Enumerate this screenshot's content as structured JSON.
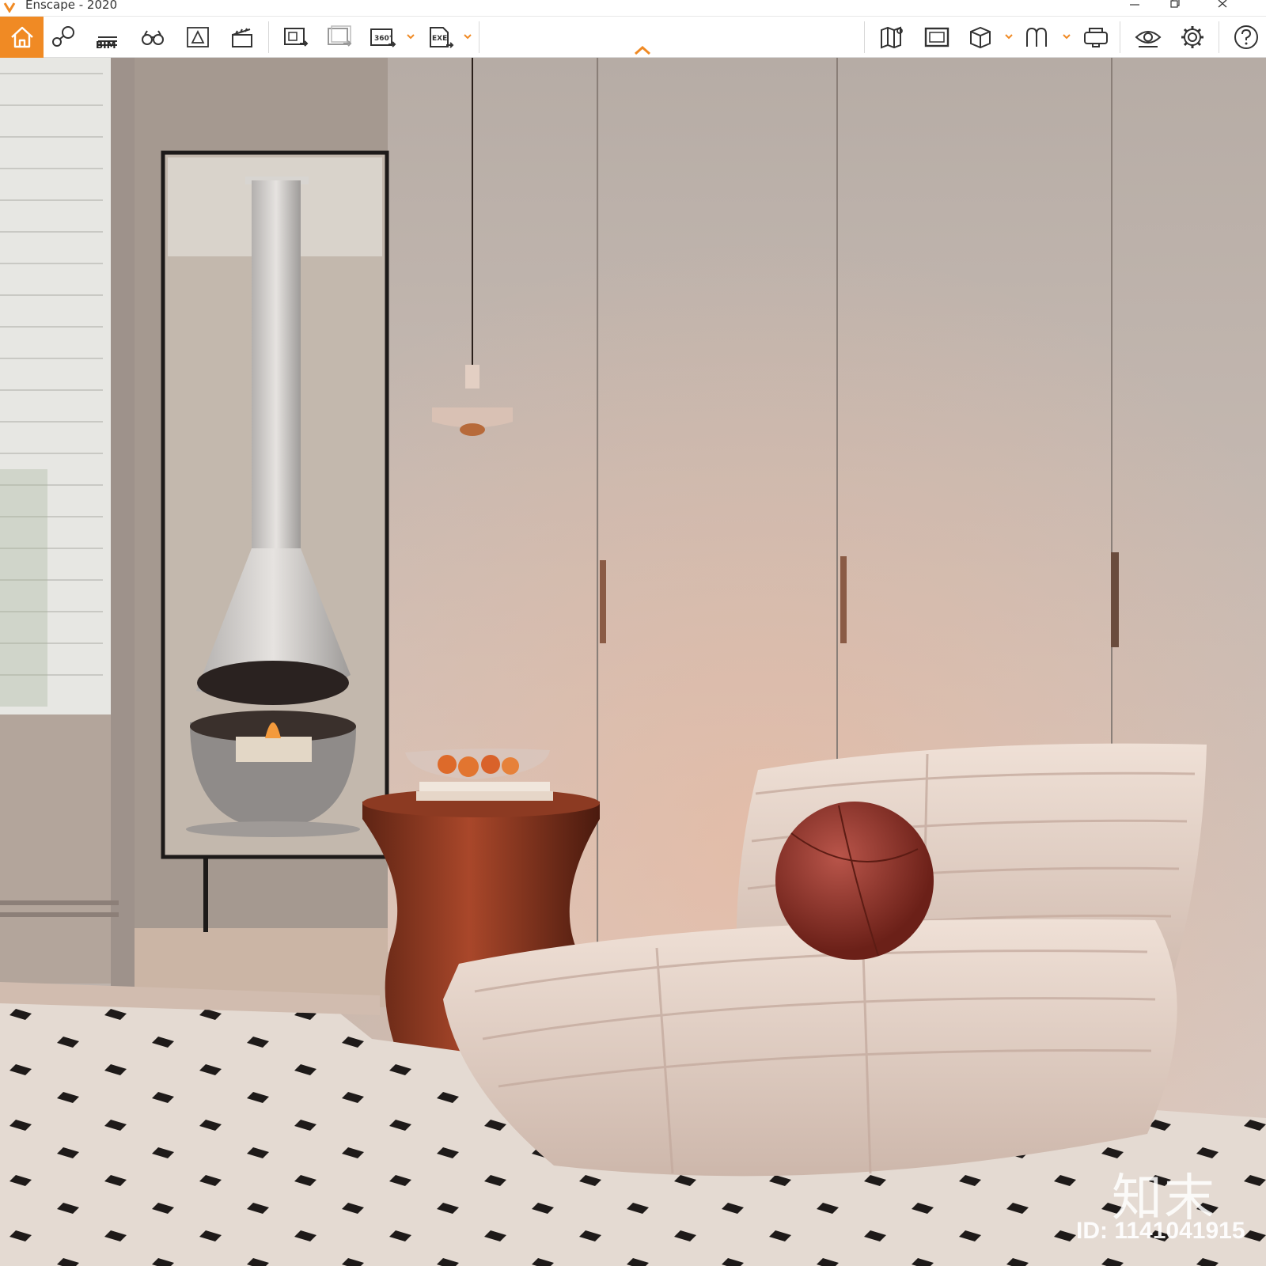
{
  "window": {
    "title": "Enscape - 2020"
  },
  "toolbar": {
    "buttons": [
      {
        "name": "home-icon",
        "label": "Home"
      },
      {
        "name": "views-icon",
        "label": "Views"
      },
      {
        "name": "bim-icon",
        "label": "BIM"
      },
      {
        "name": "binoculars-icon",
        "label": "Binoculars"
      },
      {
        "name": "sketch-icon",
        "label": "Sketch"
      },
      {
        "name": "clapperboard-icon",
        "label": "Video Editor"
      },
      {
        "name": "export-screenshot-icon",
        "label": "Screenshot"
      },
      {
        "name": "batch-render-icon",
        "label": "Batch Rendering"
      },
      {
        "name": "panorama-360-icon",
        "label": "360"
      },
      {
        "name": "exe-export-icon",
        "label": "EXE"
      },
      {
        "name": "map-icon",
        "label": "Map"
      },
      {
        "name": "render-window-icon",
        "label": "Render Window"
      },
      {
        "name": "cube-icon",
        "label": "Asset Library"
      },
      {
        "name": "material-editor-icon",
        "label": "Material Editor"
      },
      {
        "name": "vr-headset-icon",
        "label": "VR Headset"
      },
      {
        "name": "eye-icon",
        "label": "Visual Settings"
      },
      {
        "name": "gear-icon",
        "label": "Settings"
      },
      {
        "name": "help-icon",
        "label": "Help"
      }
    ],
    "bim_label": "BIM",
    "accent_color": "#f08a24"
  },
  "viewport": {
    "watermark_brand": "知末",
    "watermark_id": "ID: 1141041915"
  }
}
